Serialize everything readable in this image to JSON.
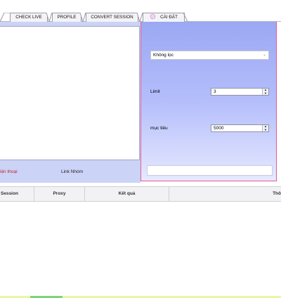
{
  "tabs": [
    {
      "label": "CHECK LIVE"
    },
    {
      "label": "PROFILE"
    },
    {
      "label": "CONVERT SESSION"
    },
    {
      "label": "CÀI ĐẶT",
      "icon": "gear-icon"
    }
  ],
  "left_panel": {
    "phone_label": "iện thoại",
    "group_link_label": "Link Nhóm"
  },
  "filter": {
    "selected": "Không lọc"
  },
  "limit": {
    "label": "Limit",
    "value": "3"
  },
  "target": {
    "label": "mục tiêu",
    "value": "5000"
  },
  "grid": {
    "columns": [
      "Session",
      "Proxy",
      "Kết quả",
      "Thô"
    ]
  },
  "colors": {
    "panel_bg": "#cbd3f6",
    "accent_border": "#e45a8e",
    "phone_label": "#c0262e"
  }
}
